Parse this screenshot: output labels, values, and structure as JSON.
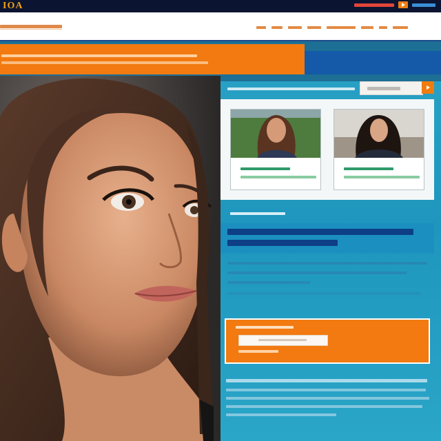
{
  "header": {
    "logo": "IOA",
    "top_links": [
      ""
    ],
    "site_title": "",
    "nav_items": [
      "",
      "",
      "",
      "",
      "",
      "",
      "",
      ""
    ]
  },
  "promo_banner": {
    "lines": [
      "",
      ""
    ]
  },
  "hero_photo": {
    "subject": "woman-portrait"
  },
  "sidebar_panel": {
    "header_text": "",
    "search_placeholder": "",
    "cards": [
      {
        "title": "",
        "subtitle": ""
      },
      {
        "title": "",
        "subtitle": ""
      }
    ],
    "section_label": "",
    "headline": "",
    "body_lines": [
      ""
    ]
  },
  "cta_box": {
    "title": "",
    "input_placeholder": "",
    "sub_text": ""
  },
  "footer": {
    "text": ""
  },
  "colors": {
    "brand_orange": "#f27a10",
    "navy": "#0b1430",
    "panel_blue": "#28a0c4",
    "headline_blue": "#0d3f86"
  }
}
